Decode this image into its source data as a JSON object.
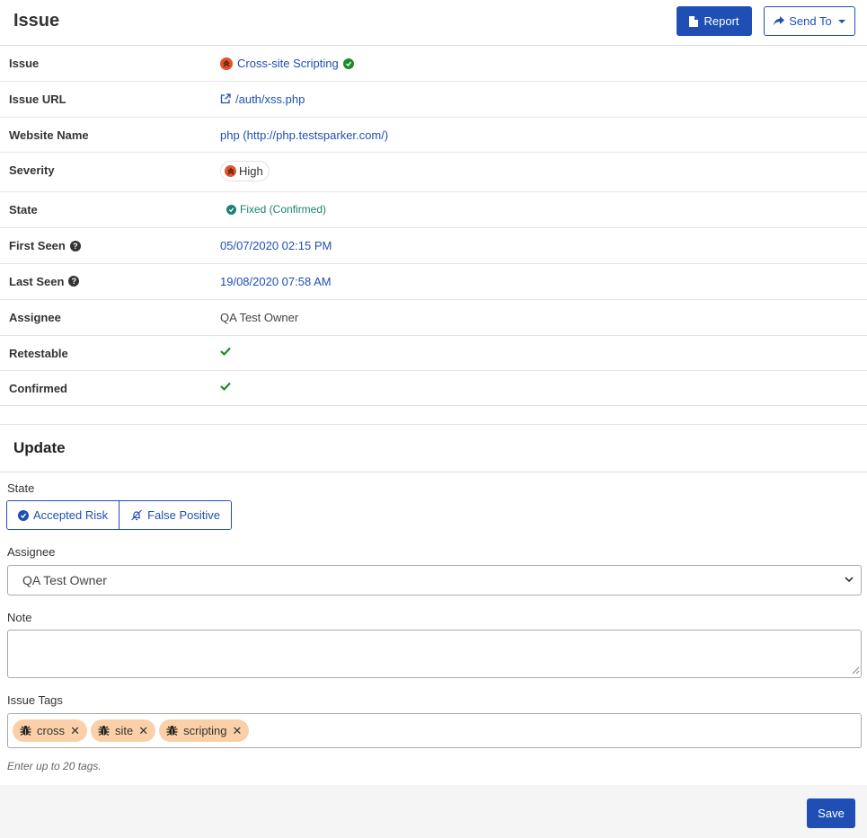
{
  "header": {
    "title": "Issue",
    "report_label": "Report",
    "send_to_label": "Send To"
  },
  "details": {
    "issue_label": "Issue",
    "issue_value": "Cross-site Scripting",
    "issue_url_label": "Issue URL",
    "issue_url_value": "/auth/xss.php",
    "website_name_label": "Website Name",
    "website_name_value": "php (http://php.testsparker.com/)",
    "severity_label": "Severity",
    "severity_value": "High",
    "state_label": "State",
    "state_value": "Fixed (Confirmed)",
    "first_seen_label": "First Seen",
    "first_seen_value": "05/07/2020 02:15 PM",
    "last_seen_label": "Last Seen",
    "last_seen_value": "19/08/2020 07:58 AM",
    "assignee_label": "Assignee",
    "assignee_value": "QA Test Owner",
    "retestable_label": "Retestable",
    "confirmed_label": "Confirmed"
  },
  "update": {
    "title": "Update",
    "state_label": "State",
    "accepted_risk_label": "Accepted Risk",
    "false_positive_label": "False Positive",
    "assignee_label": "Assignee",
    "assignee_selected": "QA Test Owner",
    "note_label": "Note",
    "note_value": "",
    "tags_label": "Issue Tags",
    "tags": [
      "cross",
      "site",
      "scripting"
    ],
    "tags_hint": "Enter up to 20 tags.",
    "save_label": "Save"
  },
  "colors": {
    "primary": "#1f4fb5",
    "severity_high": "#e0542c",
    "success": "#1a8c2a",
    "fixed": "#1b8270",
    "tag_bg": "#fbd0a8"
  }
}
